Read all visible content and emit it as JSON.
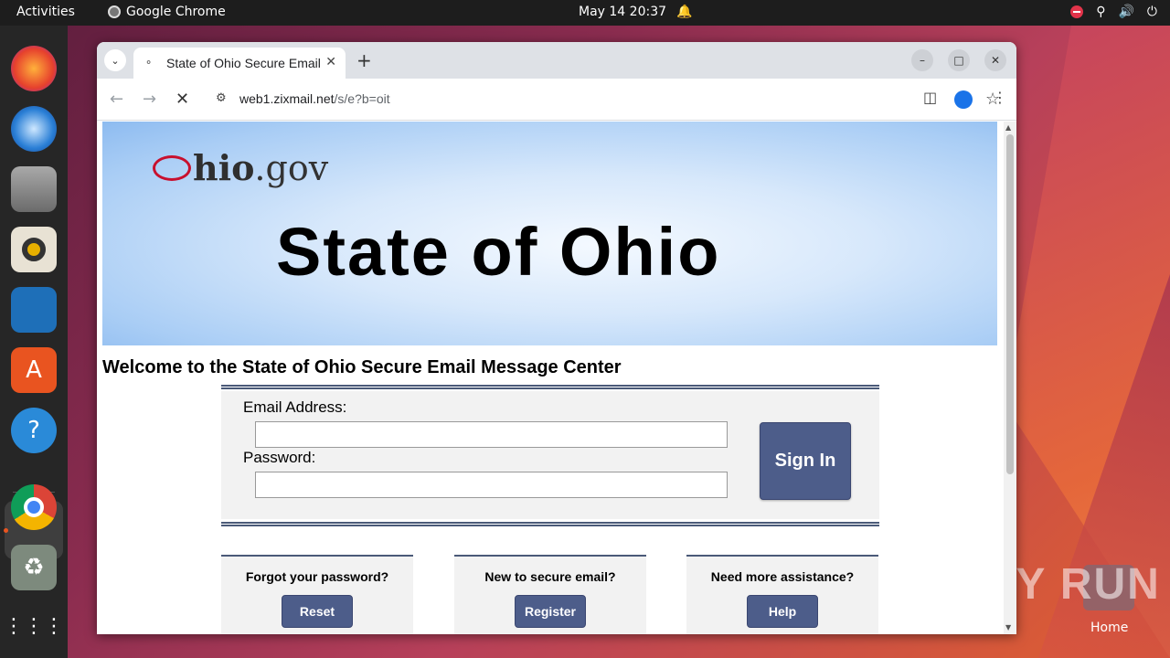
{
  "topbar": {
    "activities": "Activities",
    "app_name": "Google Chrome",
    "clock": "May 14  20:37"
  },
  "dock": {
    "items": [
      "firefox-icon",
      "thunderbird-icon",
      "files-icon",
      "rhythmbox-icon",
      "writer-icon",
      "app-center-icon",
      "help-icon",
      "chrome-icon",
      "trash-icon",
      "app-grid-icon"
    ]
  },
  "desktop": {
    "home_label": "Home",
    "watermark": "ANY RUN"
  },
  "browser": {
    "tab_title": "State of Ohio Secure Email Message Center",
    "url_host": "web1.zixmail.net",
    "url_path": "/s/e?b=oit"
  },
  "page": {
    "logo_hio": "hio",
    "logo_gov": ".gov",
    "banner_title": "State of Ohio",
    "welcome": "Welcome to the State of Ohio Secure Email Message Center",
    "email_label": "Email Address:",
    "password_label": "Password:",
    "email_value": "",
    "password_value": "",
    "signin_label": "Sign In",
    "cards": [
      {
        "text": "Forgot your password?",
        "button": "Reset"
      },
      {
        "text": "New to secure email?",
        "button": "Register"
      },
      {
        "text": "Need more assistance?",
        "button": "Help"
      }
    ]
  },
  "colors": {
    "button": "#4d5d8a",
    "rule": "#4a5a78",
    "ohio_red": "#c8102e"
  }
}
